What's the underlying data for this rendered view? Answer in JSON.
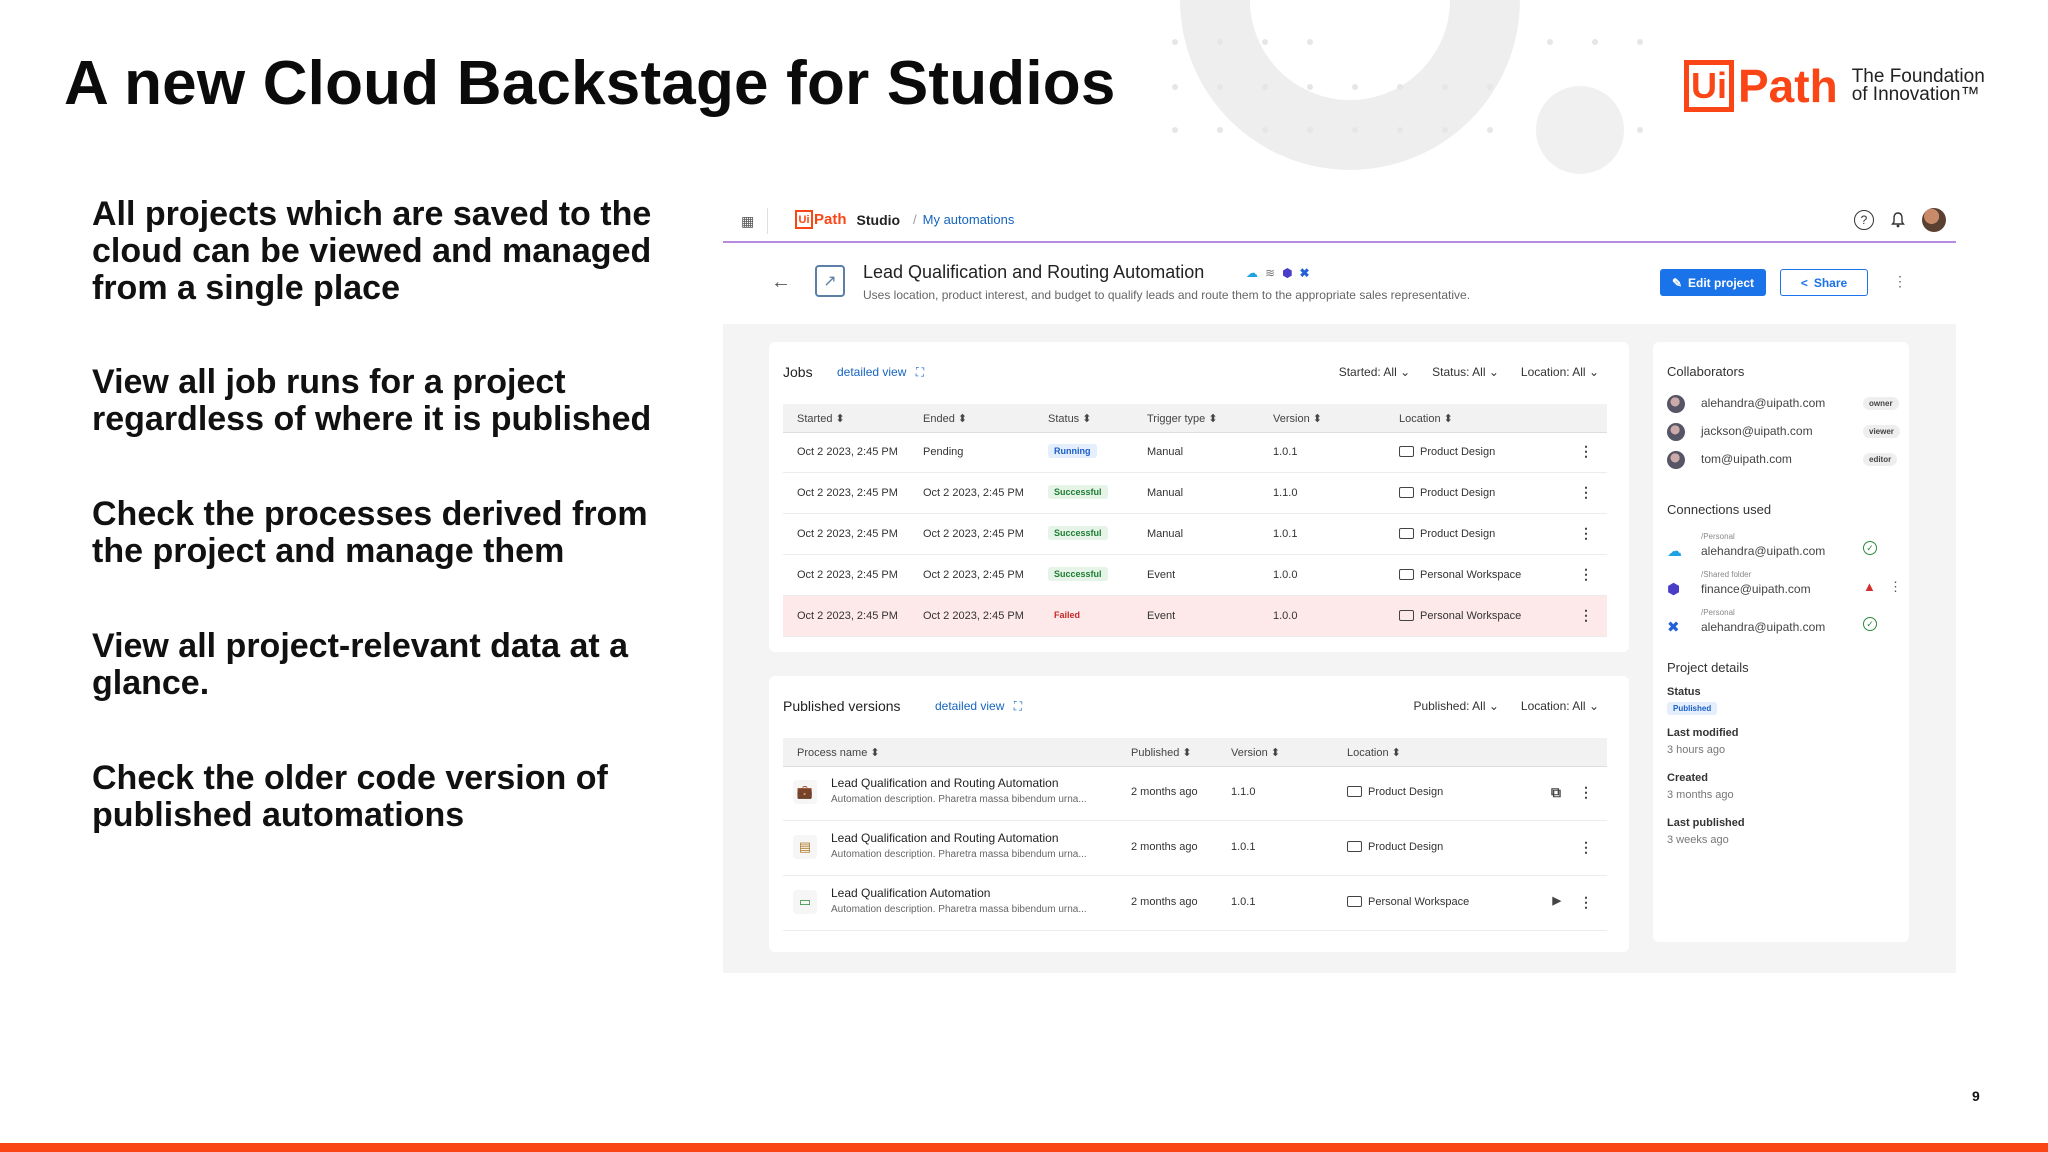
{
  "slide": {
    "title": "A new Cloud Backstage for Studios",
    "page_number": "9",
    "brand": {
      "box_letters": "Ui",
      "path": "Path",
      "tagline_1": "The Foundation",
      "tagline_2": "of Innovation™"
    },
    "bullets": [
      "All projects which are saved to the cloud can be viewed and managed from a single place",
      "View all job runs for a project regardless of where it is published",
      "Check the processes derived from the project and manage them",
      "View all project-relevant data at a glance.",
      "Check the older code version of published automations"
    ],
    "colors": {
      "brand_orange": "#fa4616",
      "primary_blue": "#1a73e8",
      "failed_row": "#fde9ea"
    }
  },
  "app": {
    "topbar": {
      "logo_box": "Ui",
      "logo_path": "Path",
      "product": "Studio",
      "breadcrumb": "My automations"
    },
    "project": {
      "title": "Lead Qualification and Routing Automation",
      "description": "Uses location, product interest, and budget to qualify leads and route them to the appropriate sales representative.",
      "edit_label": "Edit project",
      "share_label": "Share"
    },
    "jobs": {
      "title": "Jobs",
      "detail_link": "detailed view",
      "filters": [
        "Started: All",
        "Status: All",
        "Location: All"
      ],
      "columns": [
        "Started",
        "Ended",
        "Status",
        "Trigger type",
        "Version",
        "Location"
      ],
      "rows": [
        {
          "started": "Oct 2 2023, 2:45 PM",
          "ended": "Pending",
          "status": "Running",
          "trigger": "Manual",
          "version": "1.0.1",
          "location": "Product Design"
        },
        {
          "started": "Oct 2 2023, 2:45 PM",
          "ended": "Oct 2 2023, 2:45 PM",
          "status": "Successful",
          "trigger": "Manual",
          "version": "1.1.0",
          "location": "Product Design"
        },
        {
          "started": "Oct 2 2023, 2:45 PM",
          "ended": "Oct 2 2023, 2:45 PM",
          "status": "Successful",
          "trigger": "Manual",
          "version": "1.0.1",
          "location": "Product Design"
        },
        {
          "started": "Oct 2 2023, 2:45 PM",
          "ended": "Oct 2 2023, 2:45 PM",
          "status": "Successful",
          "trigger": "Event",
          "version": "1.0.0",
          "location": "Personal Workspace"
        },
        {
          "started": "Oct 2 2023, 2:45 PM",
          "ended": "Oct 2 2023, 2:45 PM",
          "status": "Failed",
          "trigger": "Event",
          "version": "1.0.0",
          "location": "Personal Workspace"
        }
      ]
    },
    "published": {
      "title": "Published versions",
      "detail_link": "detailed view",
      "filters": [
        "Published: All",
        "Location: All"
      ],
      "columns": [
        "Process name",
        "Published",
        "Version",
        "Location"
      ],
      "rows": [
        {
          "name": "Lead Qualification and Routing Automation",
          "desc": "Automation description. Pharetra massa bibendum urna...",
          "published": "2 months ago",
          "version": "1.1.0",
          "location": "Product Design",
          "icon": "briefcase-icon"
        },
        {
          "name": "Lead Qualification and Routing Automation",
          "desc": "Automation description. Pharetra massa bibendum urna...",
          "published": "2 months ago",
          "version": "1.0.1",
          "location": "Product Design",
          "icon": "form-icon"
        },
        {
          "name": "Lead Qualification Automation",
          "desc": "Automation description. Pharetra massa bibendum urna...",
          "published": "2 months ago",
          "version": "1.0.1",
          "location": "Personal Workspace",
          "icon": "laptop-icon"
        }
      ]
    },
    "side": {
      "collaborators_title": "Collaborators",
      "collaborators": [
        {
          "email": "alehandra@uipath.com",
          "role": "owner"
        },
        {
          "email": "jackson@uipath.com",
          "role": "viewer"
        },
        {
          "email": "tom@uipath.com",
          "role": "editor"
        }
      ],
      "connections_title": "Connections used",
      "connections": [
        {
          "folder": "/Personal",
          "email": "alehandra@uipath.com",
          "icon": "salesforce-icon",
          "status": "ok"
        },
        {
          "folder": "/Shared folder",
          "email": "finance@uipath.com",
          "icon": "hexagon-app-icon",
          "status": "warning"
        },
        {
          "folder": "/Personal",
          "email": "alehandra@uipath.com",
          "icon": "x-app-icon",
          "status": "ok"
        }
      ],
      "details_title": "Project details",
      "status_label": "Status",
      "status_value": "Published",
      "last_modified_label": "Last modified",
      "last_modified": "3 hours ago",
      "created_label": "Created",
      "created": "3 months ago",
      "last_published_label": "Last published",
      "last_published": "3 weeks ago"
    }
  }
}
